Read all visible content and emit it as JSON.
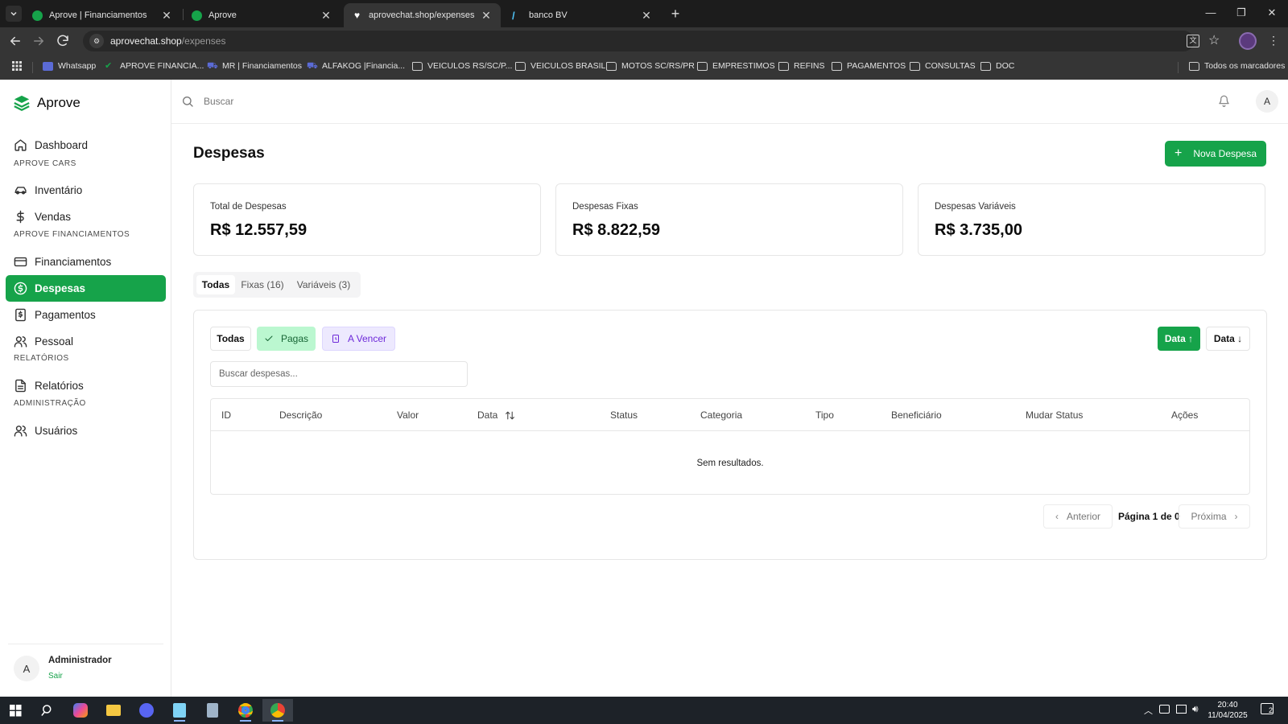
{
  "browser": {
    "tabs": [
      {
        "title": "Aprove | Financiamentos",
        "favicon": "green-check",
        "active": false
      },
      {
        "title": "Aprove",
        "favicon": "green-check",
        "active": false
      },
      {
        "title": "aprovechat.shop/expenses",
        "favicon": "heart",
        "active": true
      },
      {
        "title": "banco BV",
        "favicon": "bv-slash",
        "active": false
      }
    ],
    "url_host": "aprovechat.shop",
    "url_path": "/expenses",
    "bookmarks": [
      "Whatsapp",
      "APROVE FINANCIA...",
      "MR | Financiamentos",
      "ALFAKOG |Financia...",
      "VEICULOS RS/SC/P...",
      "VEICULOS BRASIL",
      "MOTOS SC/RS/PR",
      "EMPRESTIMOS",
      "REFINS",
      "PAGAMENTOS",
      "CONSULTAS",
      "DOC"
    ],
    "all_bookmarks": "Todos os marcadores"
  },
  "app": {
    "name": "Aprove",
    "brand_color": "#16a34a"
  },
  "sidebar": {
    "dashboard": "Dashboard",
    "sections": {
      "cars": "APROVE CARS",
      "financing": "APROVE FINANCIAMENTOS",
      "reports": "RELATÓRIOS",
      "admin": "ADMINISTRAÇÃO"
    },
    "items": {
      "inventario": "Inventário",
      "vendas": "Vendas",
      "financiamentos": "Financiamentos",
      "despesas": "Despesas",
      "pagamentos": "Pagamentos",
      "pessoal": "Pessoal",
      "relatorios": "Relatórios",
      "usuarios": "Usuários"
    },
    "user": {
      "initial": "A",
      "name": "Administrador",
      "logout": "Sair"
    }
  },
  "topbar": {
    "search_placeholder": "Buscar",
    "avatar_initial": "A"
  },
  "page": {
    "title": "Despesas",
    "new_button": "Nova Despesa",
    "cards": [
      {
        "label": "Total de Despesas",
        "value": "R$ 12.557,59"
      },
      {
        "label": "Despesas Fixas",
        "value": "R$ 8.822,59"
      },
      {
        "label": "Despesas Variáveis",
        "value": "R$ 3.735,00"
      }
    ],
    "tabs": [
      "Todas",
      "Fixas (16)",
      "Variáveis (3)"
    ],
    "filters": {
      "todas": "Todas",
      "pagas": "Pagas",
      "a_vencer": "A Vencer"
    },
    "sort": {
      "asc": "Data ↑",
      "desc": "Data ↓"
    },
    "search_placeholder": "Buscar despesas...",
    "table": {
      "columns": [
        "ID",
        "Descrição",
        "Valor",
        "Data",
        "Status",
        "Categoria",
        "Tipo",
        "Beneficiário",
        "Mudar Status",
        "Ações"
      ],
      "empty": "Sem resultados."
    },
    "pagination": {
      "prev": "Anterior",
      "info": "Página 1 de 0",
      "next": "Próxima"
    }
  },
  "taskbar": {
    "time": "20:40",
    "date": "11/04/2025",
    "notifications": "2"
  }
}
